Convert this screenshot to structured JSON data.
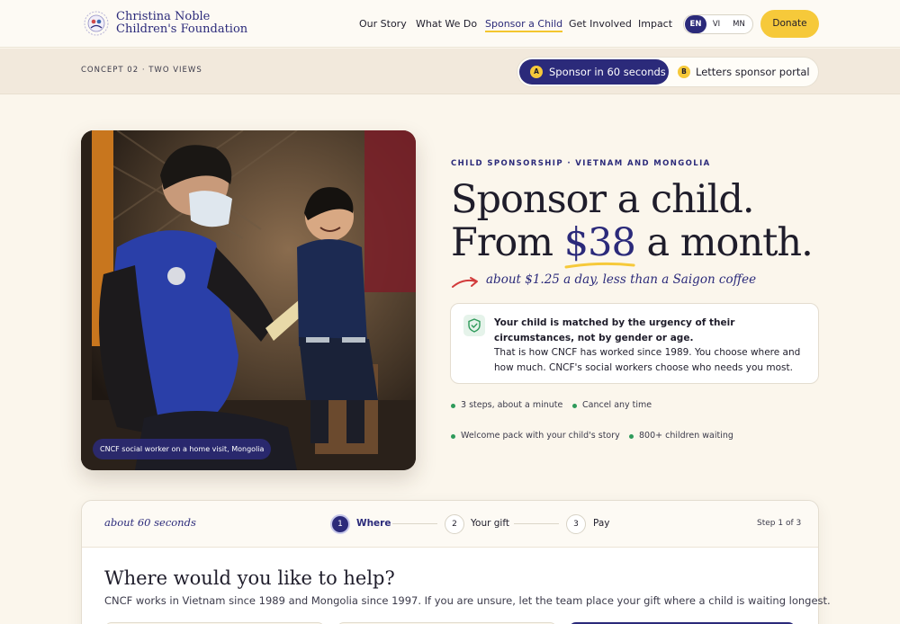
{
  "header": {
    "brand_line1": "Christina Noble",
    "brand_line2": "Children's Foundation",
    "nav": [
      "Our Story",
      "What We Do",
      "Sponsor a Child",
      "Get Involved",
      "Impact"
    ],
    "active_nav": "Sponsor a Child",
    "languages": [
      "EN",
      "VI",
      "MN"
    ],
    "active_language": "EN",
    "donate_label": "Donate"
  },
  "concept": {
    "label": "CONCEPT 02 · TWO VIEWS",
    "view_a_badge": "A",
    "view_a_label": "Sponsor in 60 seconds",
    "view_b_badge": "B",
    "view_b_label": "Letters sponsor portal"
  },
  "photo": {
    "caption": "CNCF social worker on a home visit, Mongolia"
  },
  "hero": {
    "eyebrow": "CHILD SPONSORSHIP · VIETNAM AND MONGOLIA",
    "line1": "Sponsor a child.",
    "line2_pre": "From ",
    "amount": "$38",
    "line2_post": " a month.",
    "script_note": "about $1.25 a day, less than a Saigon coffee"
  },
  "info": {
    "strong": "Your child is matched by the urgency of their circumstances, not by gender or age.",
    "body": "That is how CNCF has worked since 1989. You choose where and how much. CNCF's social workers choose who needs you most."
  },
  "bullets": [
    "3 steps, about a minute",
    "Cancel any time",
    "Welcome pack with your child's story",
    "800+ children waiting"
  ],
  "steps": {
    "script_label": "about 60 seconds",
    "items": [
      {
        "num": "1",
        "label": "Where"
      },
      {
        "num": "2",
        "label": "Your gift"
      },
      {
        "num": "3",
        "label": "Pay"
      }
    ],
    "count": "Step 1 of 3",
    "question": "Where would you like to help?",
    "subtitle": "CNCF works in Vietnam since 1989 and Mongolia since 1997. If you are unsure, let the team place your gift where a child is waiting longest."
  },
  "colors": {
    "brand_navy": "#2b2a7a",
    "accent_yellow": "#f6c93a",
    "check_green": "#2e9a5a",
    "background": "#fbf6ec"
  }
}
